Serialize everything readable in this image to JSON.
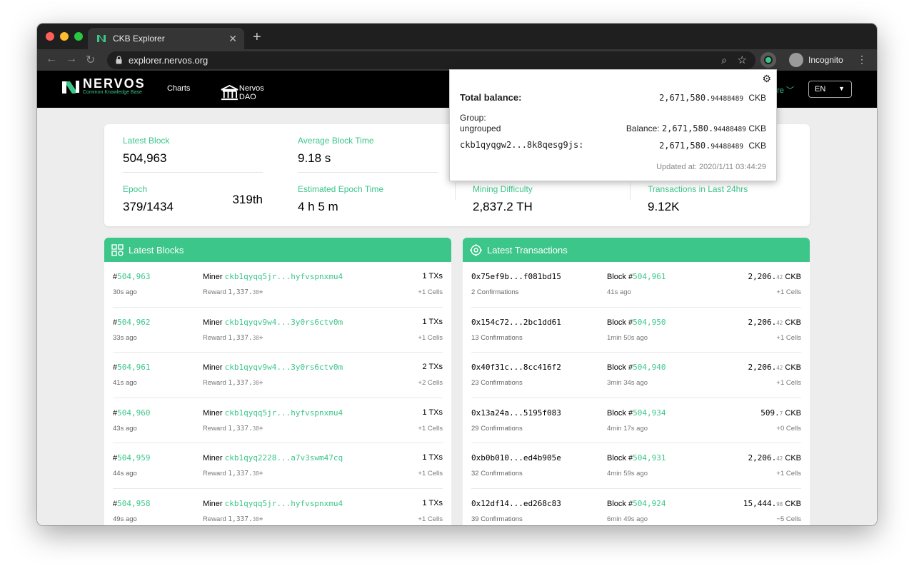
{
  "browser": {
    "tab_title": "CKB Explorer",
    "url": "explorer.nervos.org",
    "profile": "Incognito"
  },
  "header": {
    "brand": "NERVOS",
    "brand_sub": "Common Knowledge Base",
    "nav": [
      "Charts",
      "Nervos DAO"
    ],
    "more": "ore",
    "lang": "EN"
  },
  "stats": {
    "latest_block": {
      "label": "Latest Block",
      "value": "504,963"
    },
    "avg_block_time": {
      "label": "Average Block Time",
      "value": "9.18 s"
    },
    "epoch": {
      "label": "Epoch",
      "value": "379/1434",
      "ordinal": "319th"
    },
    "est_epoch_time": {
      "label": "Estimated Epoch Time",
      "value": "4 h 5 m"
    },
    "difficulty": {
      "label": "Mining Difficulty",
      "value": "2,837.2 TH"
    },
    "tx_24h": {
      "label": "Transactions in Last 24hrs",
      "value": "9.12K"
    }
  },
  "blocks_panel": {
    "title": "Latest Blocks",
    "miner_label": "Miner",
    "reward_label": "Reward",
    "rows": [
      {
        "number": "504,963",
        "age": "30s ago",
        "miner": "ckb1qyqq5jr...hyfvspnxmu4",
        "reward": "1,337.",
        "reward_dec": "38",
        "txs": "1 TXs",
        "cells": "+1 Cells"
      },
      {
        "number": "504,962",
        "age": "33s ago",
        "miner": "ckb1qyqv9w4...3y0rs6ctv0m",
        "reward": "1,337.",
        "reward_dec": "38",
        "txs": "1 TXs",
        "cells": "+1 Cells"
      },
      {
        "number": "504,961",
        "age": "41s ago",
        "miner": "ckb1qyqv9w4...3y0rs6ctv0m",
        "reward": "1,337.",
        "reward_dec": "38",
        "txs": "2 TXs",
        "cells": "+2 Cells"
      },
      {
        "number": "504,960",
        "age": "43s ago",
        "miner": "ckb1qyqq5jr...hyfvspnxmu4",
        "reward": "1,337.",
        "reward_dec": "38",
        "txs": "1 TXs",
        "cells": "+1 Cells"
      },
      {
        "number": "504,959",
        "age": "44s ago",
        "miner": "ckb1qyq2228...a7v3swm47cq",
        "reward": "1,337.",
        "reward_dec": "38",
        "txs": "1 TXs",
        "cells": "+1 Cells"
      },
      {
        "number": "504,958",
        "age": "49s ago",
        "miner": "ckb1qyqq5jr...hyfvspnxmu4",
        "reward": "1,337.",
        "reward_dec": "38",
        "txs": "1 TXs",
        "cells": "+1 Cells"
      }
    ]
  },
  "tx_panel": {
    "title": "Latest Transactions",
    "block_label": "Block #",
    "rows": [
      {
        "hash": "0x75ef9b...f081bd15",
        "confirm": "2 Confirmations",
        "block": "504,961",
        "age": "41s ago",
        "amount": "2,206.",
        "amount_dec": "42",
        "unit": "CKB",
        "cells": "+1 Cells"
      },
      {
        "hash": "0x154c72...2bc1dd61",
        "confirm": "13 Confirmations",
        "block": "504,950",
        "age": "1min 50s ago",
        "amount": "2,206.",
        "amount_dec": "42",
        "unit": "CKB",
        "cells": "+1 Cells"
      },
      {
        "hash": "0x40f31c...8cc416f2",
        "confirm": "23 Confirmations",
        "block": "504,940",
        "age": "3min 34s ago",
        "amount": "2,206.",
        "amount_dec": "42",
        "unit": "CKB",
        "cells": "+1 Cells"
      },
      {
        "hash": "0x13a24a...5195f083",
        "confirm": "29 Confirmations",
        "block": "504,934",
        "age": "4min 17s ago",
        "amount": "509.",
        "amount_dec": "7",
        "unit": "CKB",
        "cells": "+0 Cells"
      },
      {
        "hash": "0xb0b010...ed4b905e",
        "confirm": "32 Confirmations",
        "block": "504,931",
        "age": "4min 59s ago",
        "amount": "2,206.",
        "amount_dec": "42",
        "unit": "CKB",
        "cells": "+1 Cells"
      },
      {
        "hash": "0x12df14...ed268c83",
        "confirm": "39 Confirmations",
        "block": "504,924",
        "age": "6min 49s ago",
        "amount": "15,444.",
        "amount_dec": "98",
        "unit": "CKB",
        "cells": "−5 Cells"
      }
    ]
  },
  "popup": {
    "total_label": "Total balance:",
    "total_int": "2,671,580.",
    "total_dec": "94488489",
    "unit": "CKB",
    "group_label": "Group:",
    "group_value": "ungrouped",
    "balance_label": "Balance:",
    "address": "ckb1qyqgw2...8k8qesg9js:",
    "updated": "Updated at:  2020/1/11 03:44:29"
  },
  "colors": {
    "accent": "#3cc68a",
    "header_bg": "#000000"
  }
}
